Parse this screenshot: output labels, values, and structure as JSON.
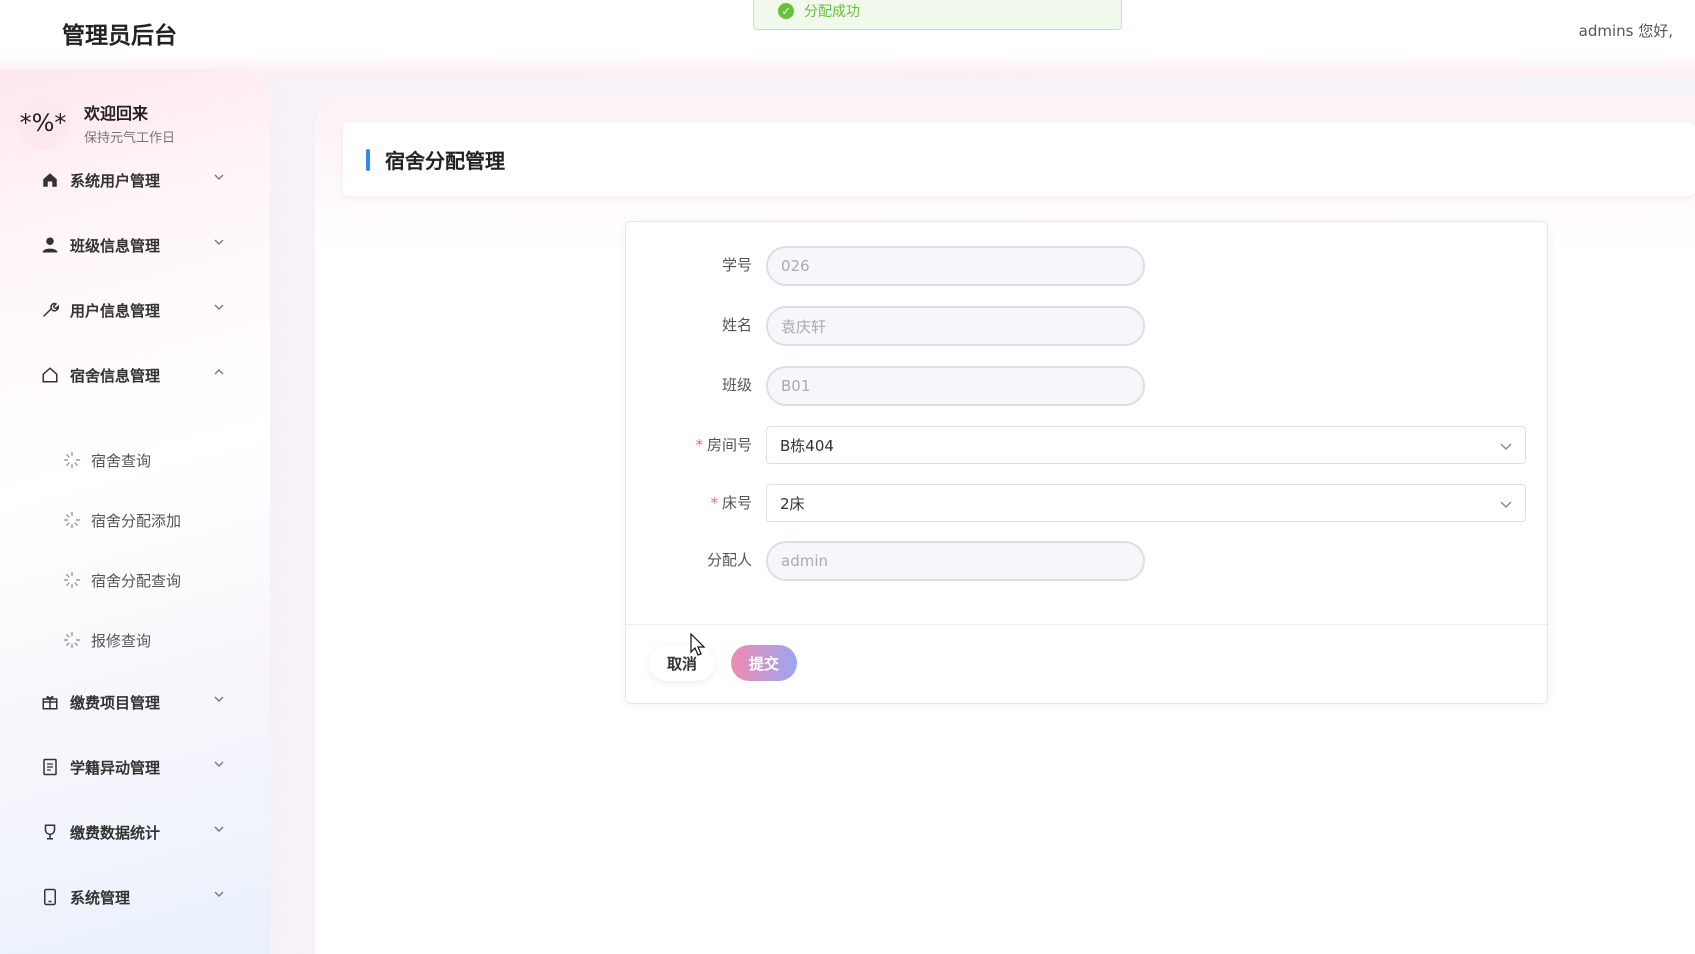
{
  "header": {
    "brand": "管理员后台",
    "greeting": "admins 您好,"
  },
  "toast": {
    "message": "分配成功"
  },
  "user_card": {
    "avatar_text": "*%*",
    "title": "欢迎回来",
    "subtitle": "保持元气工作日"
  },
  "sidebar": {
    "menus": [
      {
        "label": "系统用户管理",
        "icon": "home-icon"
      },
      {
        "label": "班级信息管理",
        "icon": "user-icon"
      },
      {
        "label": "用户信息管理",
        "icon": "wrench-icon"
      },
      {
        "label": "宿舍信息管理",
        "icon": "house-icon",
        "expanded": true
      },
      {
        "label": "缴费项目管理",
        "icon": "gift-icon"
      },
      {
        "label": "学籍异动管理",
        "icon": "document-icon"
      },
      {
        "label": "缴费数据统计",
        "icon": "trophy-icon"
      },
      {
        "label": "系统管理",
        "icon": "tablet-icon"
      }
    ],
    "sub_items": [
      {
        "label": "宿舍查询"
      },
      {
        "label": "宿舍分配添加"
      },
      {
        "label": "宿舍分配查询"
      },
      {
        "label": "报修查询"
      }
    ]
  },
  "page": {
    "title": "宿舍分配管理"
  },
  "form": {
    "student_id": {
      "label": "学号",
      "value": "026"
    },
    "name": {
      "label": "姓名",
      "value": "袁庆轩"
    },
    "class": {
      "label": "班级",
      "value": "B01"
    },
    "room": {
      "label": "房间号",
      "value": "B栋404",
      "required_mark": "*"
    },
    "bed": {
      "label": "床号",
      "value": "2床",
      "required_mark": "*"
    },
    "assigner": {
      "label": "分配人",
      "value": "admin"
    },
    "cancel_label": "取消",
    "submit_label": "提交"
  },
  "colors": {
    "accent": "#2d8cf0",
    "success": "#67c23a",
    "required": "#f56c6c"
  }
}
